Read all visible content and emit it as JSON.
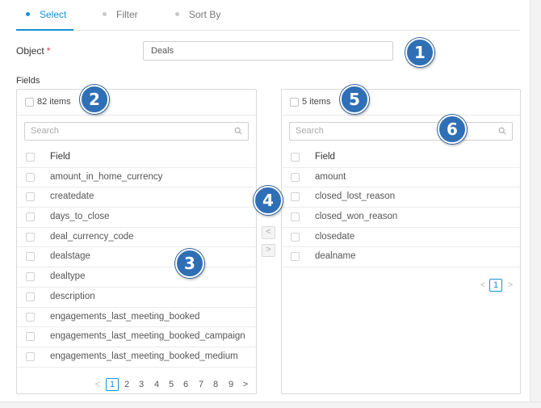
{
  "tabs": [
    {
      "label": "Select",
      "active": true
    },
    {
      "label": "Filter",
      "active": false
    },
    {
      "label": "Sort By",
      "active": false
    }
  ],
  "object": {
    "label": "Object",
    "required_mark": "*",
    "value": "Deals"
  },
  "fields_label": "Fields",
  "left_panel": {
    "count": "82 items",
    "search_placeholder": "Search",
    "header": "Field",
    "rows": [
      "amount_in_home_currency",
      "createdate",
      "days_to_close",
      "deal_currency_code",
      "dealstage",
      "dealtype",
      "description",
      "engagements_last_meeting_booked",
      "engagements_last_meeting_booked_campaign",
      "engagements_last_meeting_booked_medium"
    ],
    "pagination": {
      "prev": "<",
      "pages": [
        "1",
        "2",
        "3",
        "4",
        "5",
        "6",
        "7",
        "8",
        "9"
      ],
      "current": "1",
      "next": ">"
    }
  },
  "right_panel": {
    "count": "5 items",
    "search_placeholder": "Search",
    "header": "Field",
    "rows": [
      "amount",
      "closed_lost_reason",
      "closed_won_reason",
      "closedate",
      "dealname"
    ],
    "pagination": {
      "prev": "<",
      "pages": [
        "1"
      ],
      "current": "1",
      "next": ">"
    }
  },
  "transfer": {
    "left_arrow": "<",
    "right_arrow": ">"
  },
  "callouts": [
    "1",
    "2",
    "3",
    "4",
    "5",
    "6"
  ],
  "colors": {
    "accent": "#1890d6",
    "required": "#e0344a",
    "callout": "#2f6fb6"
  }
}
